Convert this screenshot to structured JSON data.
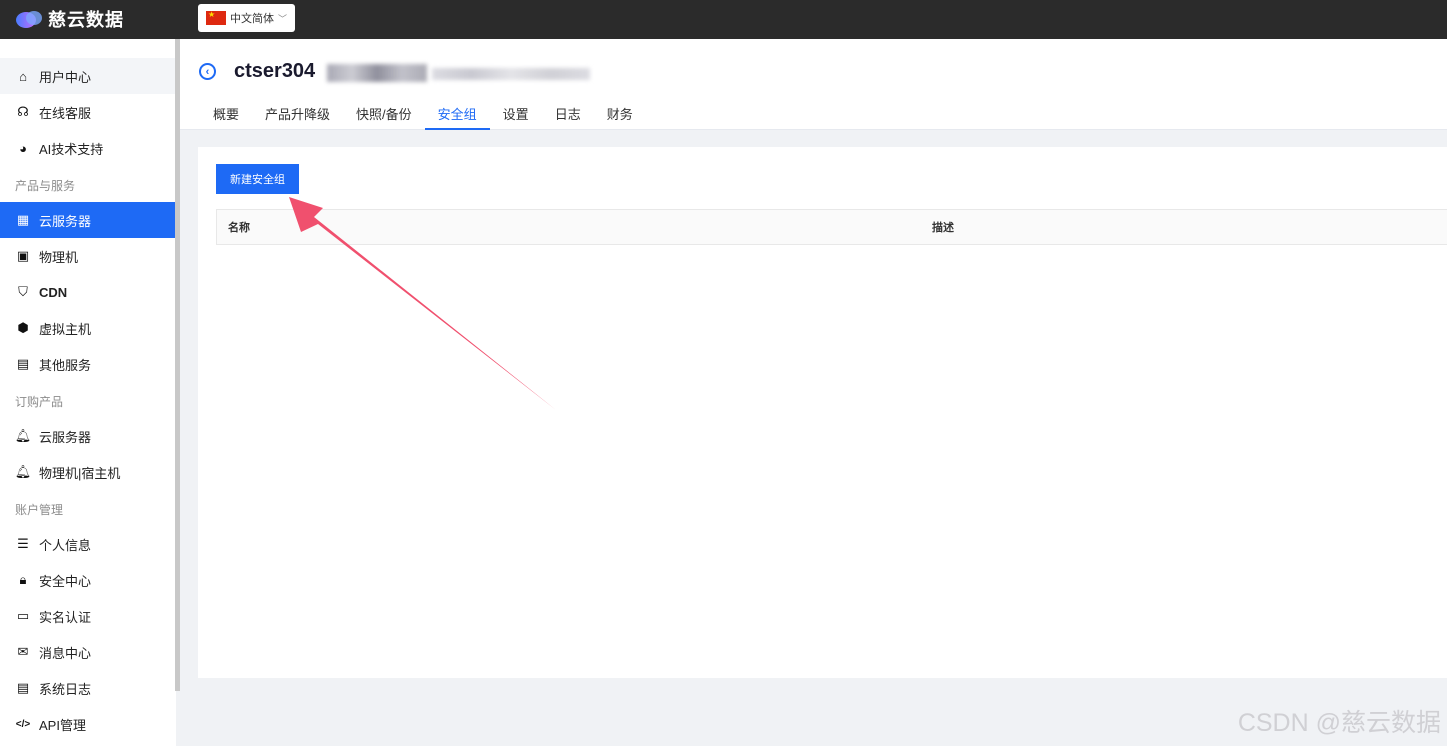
{
  "brand": {
    "name": "慈云数据"
  },
  "language": {
    "selected": "中文简体"
  },
  "sidebar": {
    "items": [
      {
        "label": "用户中心",
        "icon": "home-icon",
        "glyph": "⌂"
      },
      {
        "label": "在线客服",
        "icon": "support-icon",
        "glyph": "☊"
      },
      {
        "label": "AI技术支持",
        "icon": "globe-icon",
        "glyph": "◕"
      },
      {
        "label": "云服务器",
        "icon": "grid-icon",
        "glyph": "▦"
      },
      {
        "label": "物理机",
        "icon": "qr-icon",
        "glyph": "▣"
      },
      {
        "label": "CDN",
        "icon": "shield-icon",
        "glyph": "⛉"
      },
      {
        "label": "虚拟主机",
        "icon": "network-icon",
        "glyph": "⬢"
      },
      {
        "label": "其他服务",
        "icon": "book-icon",
        "glyph": "▤"
      },
      {
        "label": "云服务器",
        "icon": "bell-icon",
        "glyph": "🔔︎"
      },
      {
        "label": "物理机|宿主机",
        "icon": "bell-icon",
        "glyph": "🔔︎"
      },
      {
        "label": "个人信息",
        "icon": "user-list-icon",
        "glyph": "☰"
      },
      {
        "label": "安全中心",
        "icon": "lock-icon",
        "glyph": "🔒︎"
      },
      {
        "label": "实名认证",
        "icon": "card-icon",
        "glyph": "▭"
      },
      {
        "label": "消息中心",
        "icon": "mail-icon",
        "glyph": "✉"
      },
      {
        "label": "系统日志",
        "icon": "file-icon",
        "glyph": "▤"
      },
      {
        "label": "API管理",
        "icon": "code-icon",
        "glyph": "</>"
      }
    ],
    "groups": [
      "产品与服务",
      "订购产品",
      "账户管理"
    ],
    "active_label": "云服务器"
  },
  "header": {
    "title": "ctser304",
    "back_icon": "chevron-left-circle-icon",
    "tabs": [
      "概要",
      "产品升降级",
      "快照/备份",
      "安全组",
      "设置",
      "日志",
      "财务"
    ],
    "active_tab": "安全组"
  },
  "panel": {
    "new_button": "新建安全组",
    "columns": [
      "名称",
      "描述"
    ]
  },
  "colors": {
    "accent": "#1e6af5",
    "topbar": "#2b2b2b",
    "annotation_arrow": "#f0506e"
  },
  "watermark": "CSDN @慈云数据"
}
